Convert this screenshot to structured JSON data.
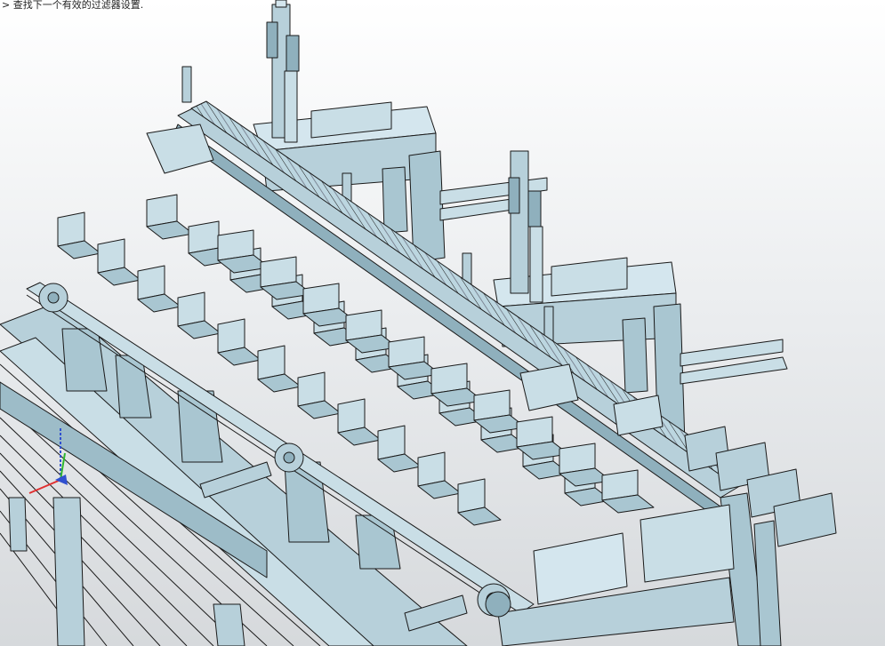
{
  "status": {
    "prompt_marker": ">",
    "message": "查找下一个有效的过滤器设置."
  },
  "viewport": {
    "background_top": "#ffffff",
    "background_bottom": "#d6d9dc",
    "model_fill": "#b7d0da",
    "model_fill_dark": "#8fb0bd",
    "model_fill_light": "#d4e6ee",
    "edge_color": "#1a1a1a"
  },
  "triad": {
    "x_axis_color": "#e03030",
    "y_axis_color": "#2fb62f",
    "z_axis_color": "#3050d0"
  }
}
